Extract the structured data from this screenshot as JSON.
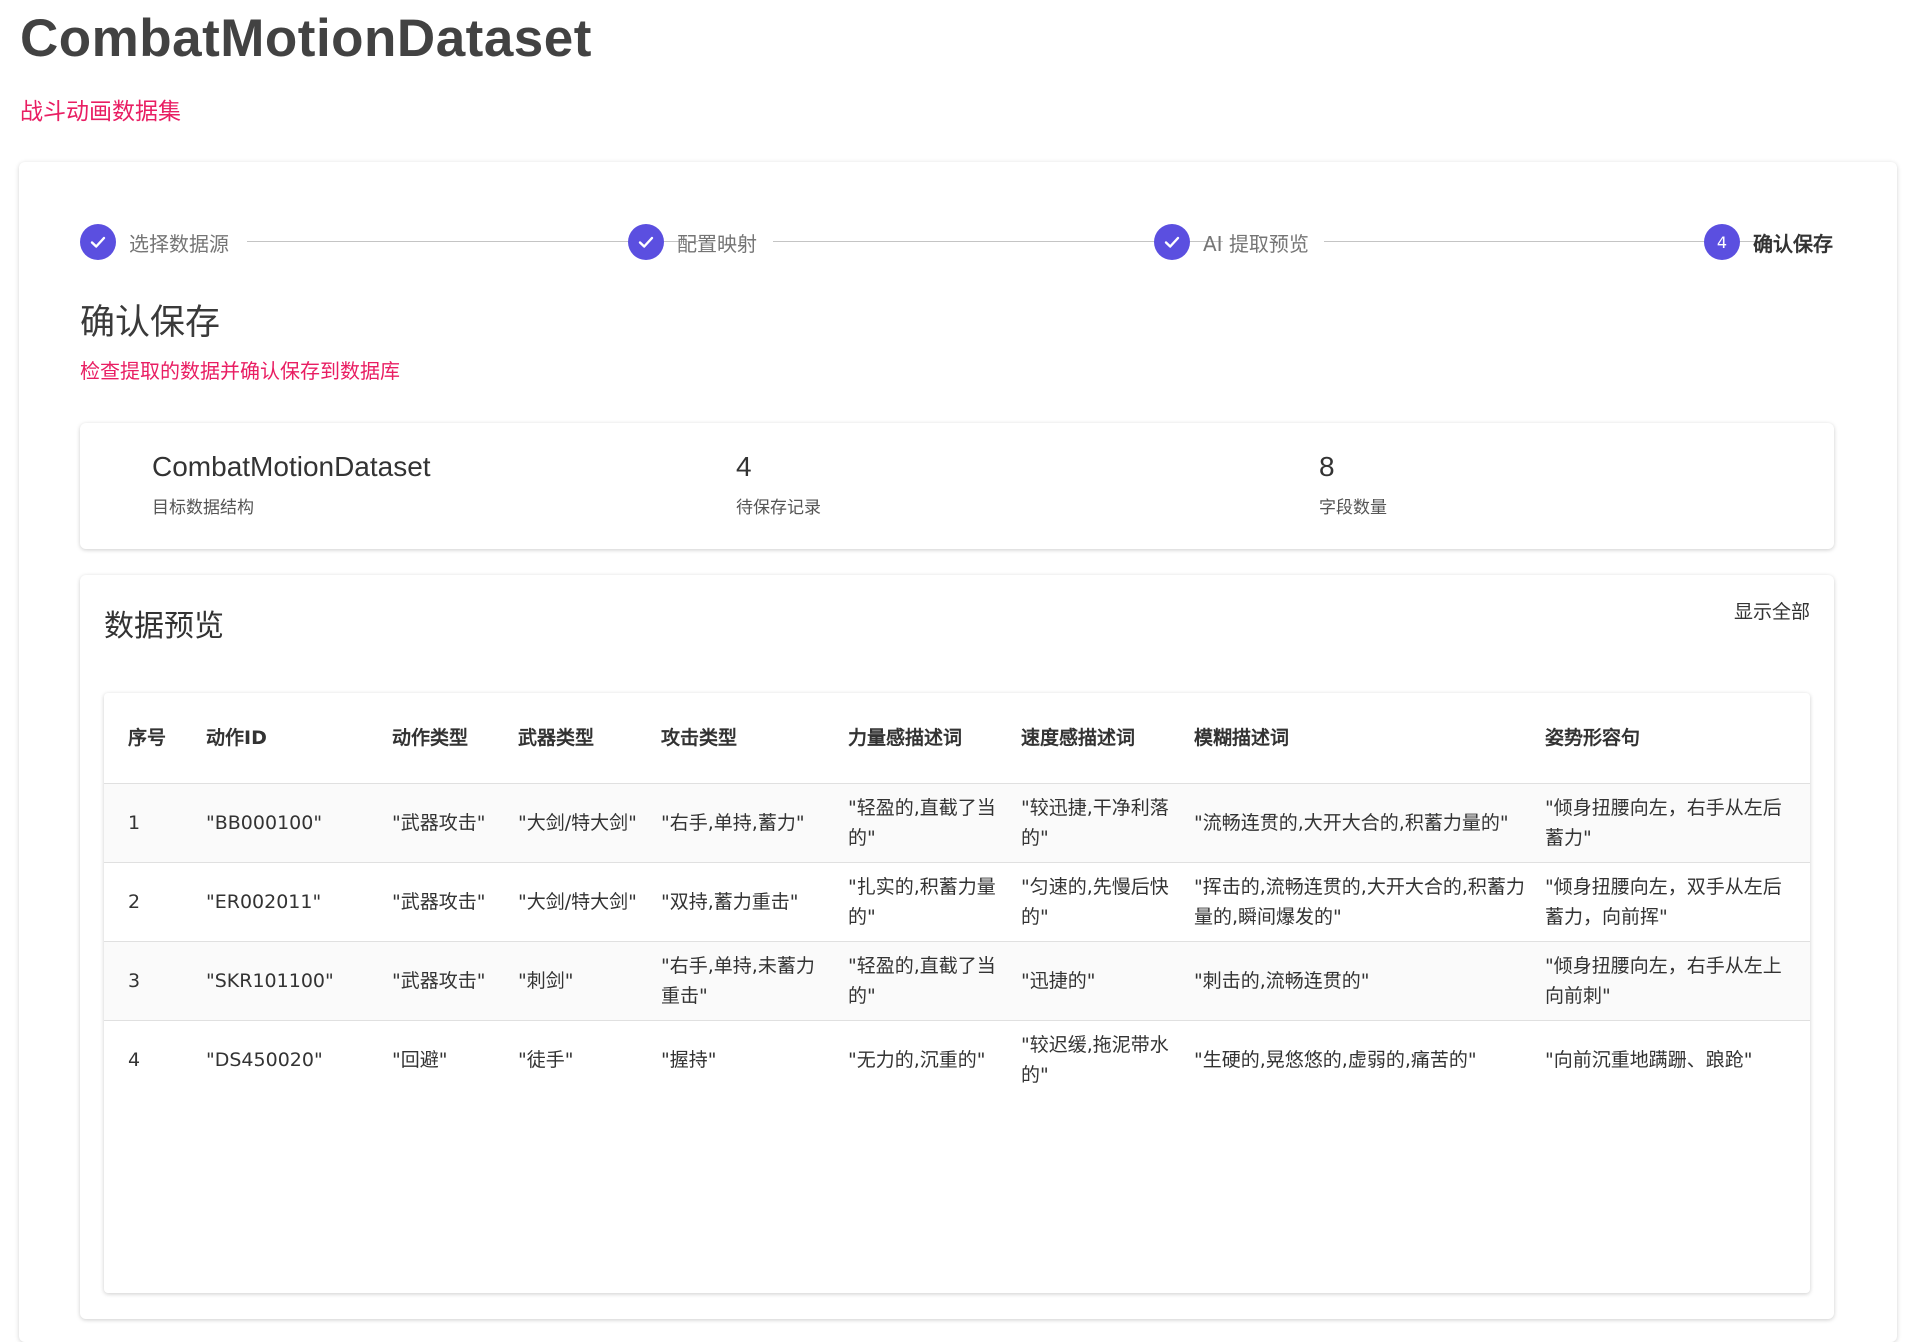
{
  "header": {
    "title": "CombatMotionDataset",
    "subtitle": "战斗动画数据集"
  },
  "stepper": {
    "steps": [
      {
        "label": "选择数据源",
        "state": "done"
      },
      {
        "label": "配置映射",
        "state": "done"
      },
      {
        "label": "AI 提取预览",
        "state": "done"
      },
      {
        "label": "确认保存",
        "state": "active",
        "number": "4"
      }
    ],
    "accent_color": "#5b4fe0"
  },
  "section": {
    "title": "确认保存",
    "subtitle": "检查提取的数据并确认保存到数据库"
  },
  "summary": {
    "stats": [
      {
        "value": "CombatMotionDataset",
        "label": "目标数据结构"
      },
      {
        "value": "4",
        "label": "待保存记录"
      },
      {
        "value": "8",
        "label": "字段数量"
      }
    ]
  },
  "preview": {
    "title": "数据预览",
    "show_all_label": "显示全部",
    "columns": [
      "序号",
      "动作ID",
      "动作类型",
      "武器类型",
      "攻击类型",
      "力量感描述词",
      "速度感描述词",
      "模糊描述词",
      "姿势形容句"
    ],
    "rows": [
      [
        "1",
        "\"BB000100\"",
        "\"武器攻击\"",
        "\"大剑/特大剑\"",
        "\"右手,单持,蓄力\"",
        "\"轻盈的,直截了当的\"",
        "\"较迅捷,干净利落的\"",
        "\"流畅连贯的,大开大合的,积蓄力量的\"",
        "\"倾身扭腰向左，右手从左后蓄力\""
      ],
      [
        "2",
        "\"ER002011\"",
        "\"武器攻击\"",
        "\"大剑/特大剑\"",
        "\"双持,蓄力重击\"",
        "\"扎实的,积蓄力量的\"",
        "\"匀速的,先慢后快的\"",
        "\"挥击的,流畅连贯的,大开大合的,积蓄力量的,瞬间爆发的\"",
        "\"倾身扭腰向左，双手从左后蓄力，向前挥\""
      ],
      [
        "3",
        "\"SKR101100\"",
        "\"武器攻击\"",
        "\"刺剑\"",
        "\"右手,单持,未蓄力重击\"",
        "\"轻盈的,直截了当的\"",
        "\"迅捷的\"",
        "\"刺击的,流畅连贯的\"",
        "\"倾身扭腰向左，右手从左上向前刺\""
      ],
      [
        "4",
        "\"DS450020\"",
        "\"回避\"",
        "\"徒手\"",
        "\"握持\"",
        "\"无力的,沉重的\"",
        "\"较迟缓,拖泥带水的\"",
        "\"生硬的,晃悠悠的,虚弱的,痛苦的\"",
        "\"向前沉重地蹒跚、踉跄\""
      ]
    ]
  },
  "colors": {
    "accent_pink": "#e91e63",
    "step_purple": "#5b4fe0"
  }
}
